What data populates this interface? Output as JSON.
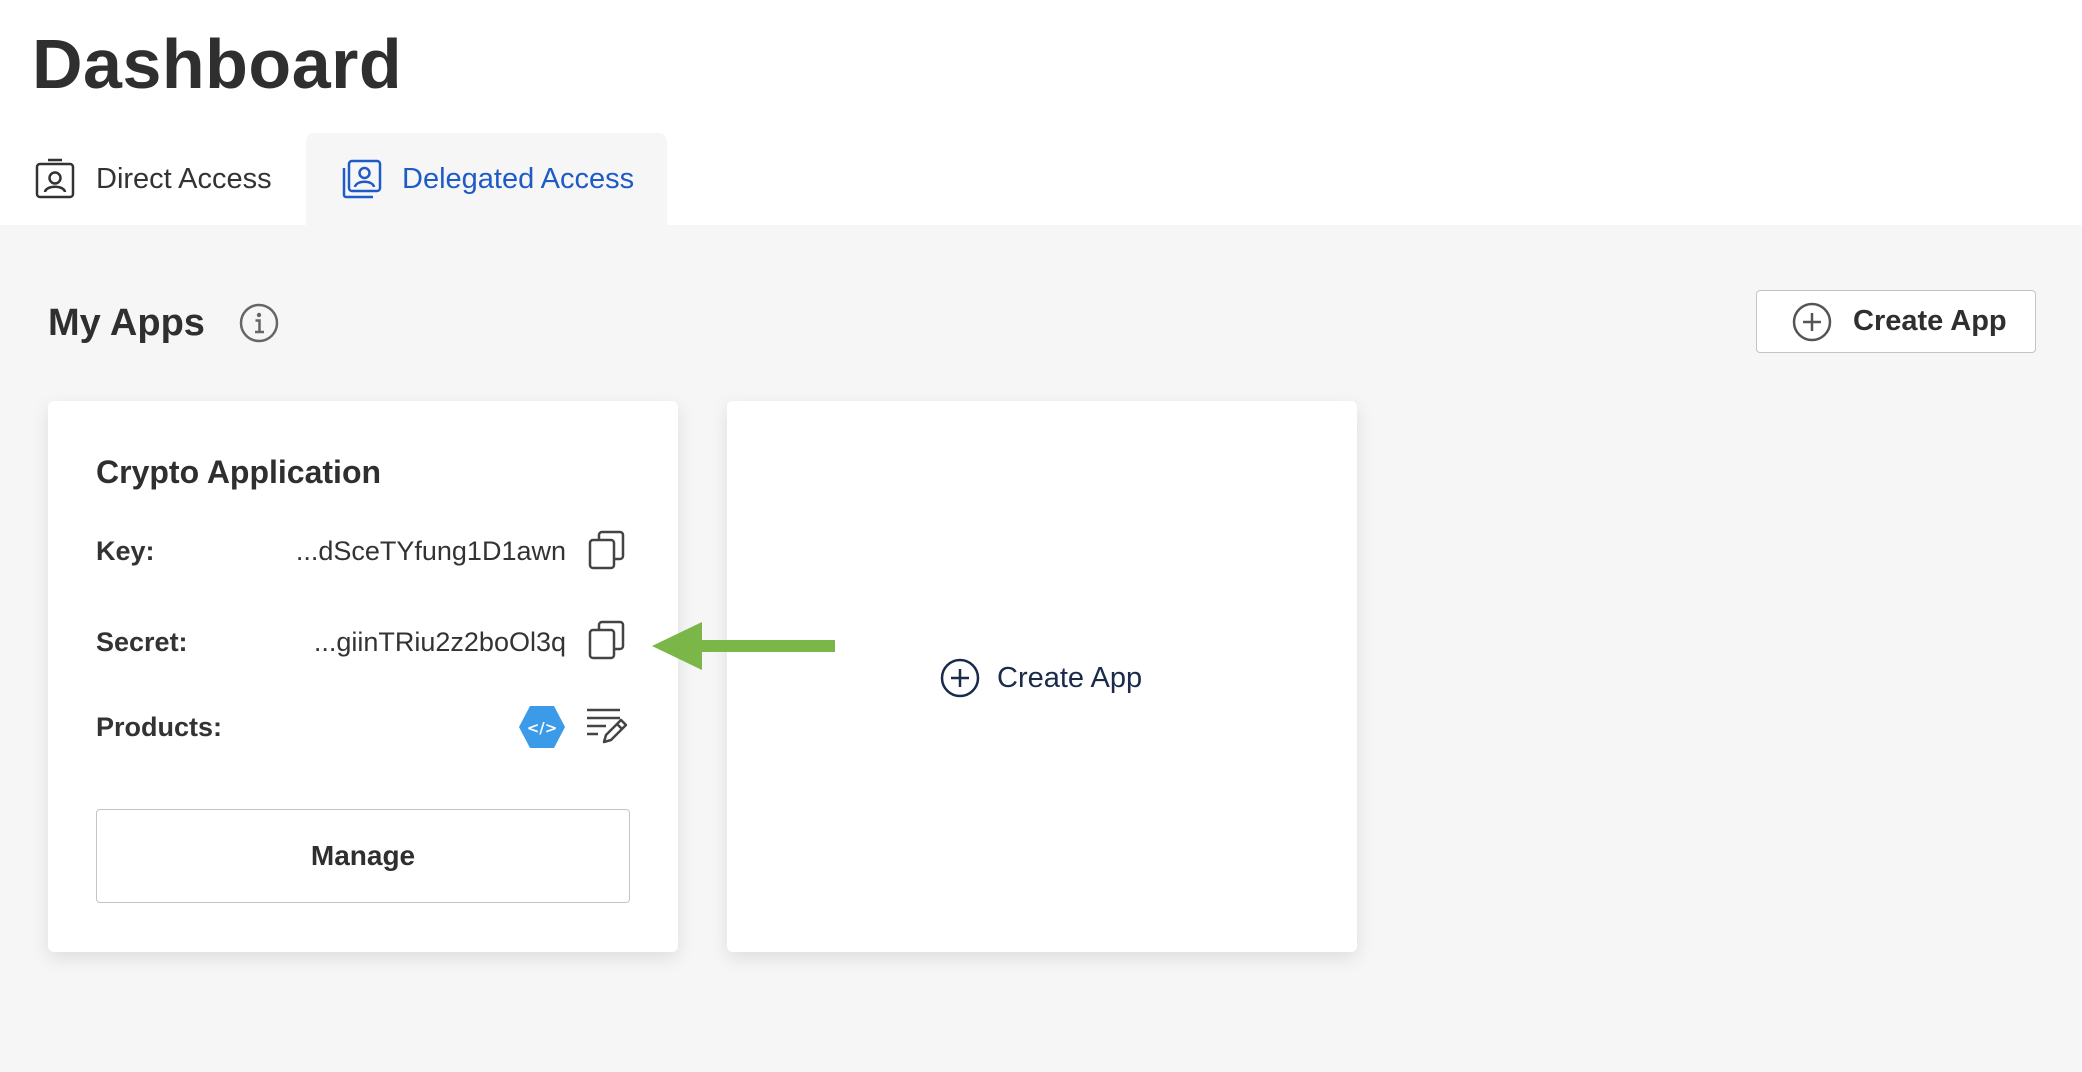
{
  "header": {
    "title": "Dashboard"
  },
  "tabs": [
    {
      "label": "Direct Access",
      "icon": "user-badge-icon",
      "active": false
    },
    {
      "label": "Delegated Access",
      "icon": "user-badges-icon",
      "active": true
    }
  ],
  "colors": {
    "active_tab": "#1e5bc6",
    "content_bg": "#f6f6f6",
    "arrow": "#7ab648",
    "product_badge": "#3b9be8"
  },
  "my_apps": {
    "title": "My Apps",
    "info_icon": "info-icon",
    "create_button_label": "Create App"
  },
  "app_card": {
    "name": "Crypto Application",
    "key_label": "Key:",
    "key_value": "...dSceTYfung1D1awn",
    "secret_label": "Secret:",
    "secret_value": "...giinTRiu2z2boOl3q",
    "products_label": "Products:",
    "product_icon": "code-hexagon-icon",
    "edit_products_icon": "edit-list-icon",
    "manage_label": "Manage"
  },
  "new_app_card": {
    "label": "Create App"
  }
}
